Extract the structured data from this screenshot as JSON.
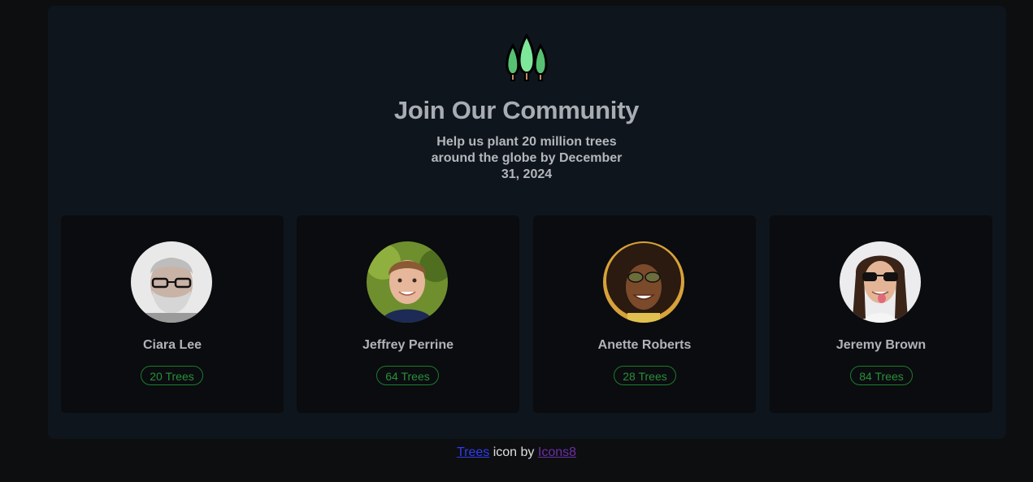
{
  "header": {
    "logo_icon": "trees-icon",
    "title": "Join Our Community",
    "subtitle_lines": [
      "Help us plant 20 million trees",
      "around the globe by December",
      "31, 2024"
    ]
  },
  "members": [
    {
      "name": "Ciara Lee",
      "trees": "20 Trees",
      "avatar": "avatar-photo-elderly-man-glasses-beard"
    },
    {
      "name": "Jeffrey Perrine",
      "trees": "64 Trees",
      "avatar": "avatar-photo-boy"
    },
    {
      "name": "Anette Roberts",
      "trees": "28 Trees",
      "avatar": "avatar-photo-woman-sunglasses"
    },
    {
      "name": "Jeremy Brown",
      "trees": "84 Trees",
      "avatar": "avatar-photo-man-sunglasses-tongue"
    }
  ],
  "footer": {
    "link1": "Trees",
    "middle": " icon by ",
    "link2": "Icons8"
  },
  "colors": {
    "page_bg": "#0d0e10",
    "panel_bg": "#0f151c",
    "card_bg": "#0a0c0f",
    "badge_green": "#2a8f3a",
    "tree_green": "#6fdc8c"
  }
}
